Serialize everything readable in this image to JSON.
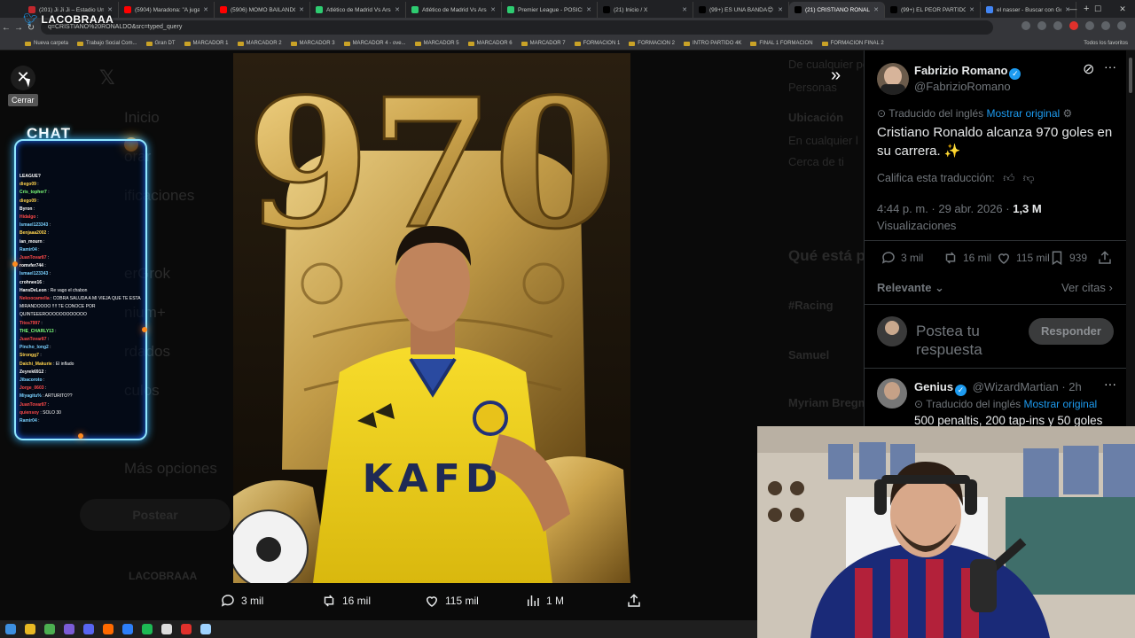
{
  "browser": {
    "tabs": [
      {
        "label": "(201) Ji Ji Ji – Estadio Únic",
        "favicon": "#c1272d",
        "active": false
      },
      {
        "label": "(5904) Maradona: \"A jugar",
        "favicon": "#ff0000",
        "active": false
      },
      {
        "label": "(5906) MOMO BAILANDO",
        "favicon": "#ff0000",
        "active": false
      },
      {
        "label": "Atlético de Madrid Vs Ars",
        "favicon": "#2ecc71",
        "active": false
      },
      {
        "label": "Atlético de Madrid Vs Ars",
        "favicon": "#2ecc71",
        "active": false
      },
      {
        "label": "Premier League - POSICIÓ",
        "favicon": "#2ecc71",
        "active": false
      },
      {
        "label": "(21) Inicio / X",
        "favicon": "#000000",
        "active": false
      },
      {
        "label": "(99+) ES UNA BANDA😊",
        "favicon": "#000000",
        "active": false
      },
      {
        "label": "(21) CRISTIANO RONALDO",
        "favicon": "#000000",
        "active": true
      },
      {
        "label": "(99+) EL PEOR PARTIDO D",
        "favicon": "#000000",
        "active": false
      },
      {
        "label": "el nasser - Buscar con Go",
        "favicon": "#4285f4",
        "active": false
      }
    ],
    "url": "q=CRISTIANO%20RONALDO&src=typed_query",
    "bookmarks": [
      "Nueva carpeta",
      "Trabajo Social Com...",
      "Gran DT",
      "MARCADOR 1",
      "MARCADOR 2",
      "MARCADOR 3",
      "MARCADOR 4 - ove...",
      "MARCADOR 5",
      "MARCADOR 6",
      "MARCADOR 7",
      "FORMACION 1",
      "FORMACION 2",
      "INTRO PARTIDO 4K",
      "FINAL 1 FORMACION",
      "FORMACION FINAL 2"
    ],
    "bookmarks_all": "Todos los favoritos"
  },
  "overlay": {
    "close_tooltip": "Cerrar",
    "stream_logo": "LACOBRAAA"
  },
  "background_nav": {
    "items": [
      "Inicio",
      "orar",
      "ificaciones",
      "erGrok",
      "nium+",
      "rdados",
      "culos",
      "Más opciones"
    ],
    "post_button": "Postear",
    "account": "LACOBRAAA"
  },
  "background_mid": {
    "items": [
      "De cualquier pe",
      "Personas",
      "Ubicación",
      "En cualquier l",
      "Cerca de ti",
      "Qué está p",
      "#Racing",
      "Samuel",
      "Myriam Bregm"
    ]
  },
  "chat": {
    "title": "CHAT",
    "lines": [
      {
        "user": "LEAGUE?",
        "color": "#ffffff",
        "text": ""
      },
      {
        "user": "diego09",
        "color": "#ffd34d",
        "text": ":"
      },
      {
        "user": "Cris_topher7",
        "color": "#7dff7a",
        "text": ":"
      },
      {
        "user": "diego09",
        "color": "#ffd34d",
        "text": ":"
      },
      {
        "user": "Byron",
        "color": "#ffffff",
        "text": ":"
      },
      {
        "user": "Hidalgo",
        "color": "#ff4a4a",
        "text": ":"
      },
      {
        "user": "Ismael123343",
        "color": "#7ad1ff",
        "text": ":"
      },
      {
        "user": "Benjaaa2002",
        "color": "#ffd34d",
        "text": ":"
      },
      {
        "user": "ian_mourn",
        "color": "#ffffff",
        "text": ":"
      },
      {
        "user": "Ramir04",
        "color": "#7ad1ff",
        "text": ":"
      },
      {
        "user": "JuanTovar87",
        "color": "#ff4a4a",
        "text": ":"
      },
      {
        "user": "romvfer744",
        "color": "#ffffff",
        "text": ":"
      },
      {
        "user": "Ismael123343",
        "color": "#7ad1ff",
        "text": ":"
      },
      {
        "user": "crohnee16",
        "color": "#ffffff",
        "text": ":"
      },
      {
        "user": "HansDeLeon",
        "color": "#ffffff",
        "text": ": Re vago el chabon"
      },
      {
        "user": "Nekoocamelia",
        "color": "#ff4a4a",
        "text": ": COBRA SALUDA A MI VIEJA QUE TE ESTA"
      },
      {
        "user": "",
        "color": "#ffffff",
        "text": "MIRANDOOOO !!!! TE CONOCE POR"
      },
      {
        "user": "",
        "color": "#ffffff",
        "text": "QUINTEEEROOOOOOOOOOOO"
      },
      {
        "user": "Titos7997",
        "color": "#ff4a4a",
        "text": ":"
      },
      {
        "user": "THE_CHARLY13",
        "color": "#7dff7a",
        "text": ":"
      },
      {
        "user": "JuanTovar87",
        "color": "#ff4a4a",
        "text": ":"
      },
      {
        "user": "Pincho_long2",
        "color": "#7ad1ff",
        "text": ":"
      },
      {
        "user": "Strongg7",
        "color": "#ffd34d",
        "text": ":"
      },
      {
        "user": "Daichi_Makurie",
        "color": "#ffd34d",
        "text": ": El inflado"
      },
      {
        "user": "Zeyrek6912",
        "color": "#ffffff",
        "text": ":"
      },
      {
        "user": "Jibacoroto",
        "color": "#7ad1ff",
        "text": ":"
      },
      {
        "user": "Jorge_0603",
        "color": "#ff4a4a",
        "text": ":"
      },
      {
        "user": "Miyagitu%",
        "color": "#7ad1ff",
        "text": ": ARTURITO??"
      },
      {
        "user": "JuanTovar87",
        "color": "#ff4a4a",
        "text": ":"
      },
      {
        "user": "quiensoy",
        "color": "#ff4a4a",
        "text": ": SOLO 30"
      },
      {
        "user": "Ramir04",
        "color": "#7ad1ff",
        "text": ":"
      }
    ]
  },
  "photo_text": "970",
  "image_actions": {
    "replies": "3 mil",
    "reposts": "16 mil",
    "likes": "115 mil",
    "views": "1 M"
  },
  "tweet": {
    "author_name": "Fabrizio Romano",
    "author_handle": "@FabrizioRomano",
    "translated_note": "Traducido del inglés",
    "show_original": "Mostrar original",
    "text": "Cristiano Ronaldo alcanza 970 goles en su carrera. ✨",
    "rate_translation": "Califica esta traducción:",
    "timestamp": "4:44 p. m. · 29 abr. 2026 ·",
    "views_count": "1,3 M",
    "views_label": "Visualizaciones",
    "stats": {
      "replies": "3 mil",
      "reposts": "16 mil",
      "likes": "115 mil",
      "bookmarks": "939"
    },
    "sort_label": "Relevante",
    "quotes_link": "Ver citas",
    "reply_placeholder_line1": "Postea tu",
    "reply_placeholder_line2": "respuesta",
    "reply_button": "Responder"
  },
  "reply": {
    "author_name": "Genius",
    "author_handle": "@WizardMartian",
    "time": "· 2h",
    "translated_note": "Traducido del inglés",
    "show_original": "Mostrar original",
    "text": "500 penaltis, 200 tap-ins y 50 goles"
  },
  "colors": {
    "accent": "#1d9bf0",
    "jersey": "#f3d21c",
    "gold": "#c9a14a"
  }
}
